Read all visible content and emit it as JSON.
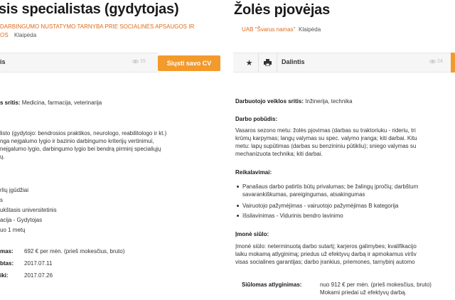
{
  "left": {
    "title": "sis specialistas (gydytojas)",
    "company_line1": "DARBINGUMO NUSTATYMO TARNYBA PRIE SOCIALINĖS APSAUGOS IR",
    "company_line2": "OS",
    "city": "Klaipėda",
    "views": "15",
    "cv_button": "Siųsti savo CV",
    "toolbar_fragment": "is",
    "area_label": "s sritis:",
    "area_value": "Medicina, farmacija, veterinarija",
    "desc_lines": [
      "listo (gydytojo: bendrosios praktikos, neurologo, reabilitologo ir kt.)",
      "nga neįgalumo lygio ir bazinio darbingumo kriterijų vertinimui,",
      "neįgalumo lygio, darbingumo lygio bei bendrą pirminį specialiųjų",
      "ų."
    ],
    "req_lines": [
      "rlių įgūdžiai",
      "s",
      "ukštasis universitetinis",
      "acija - Gydytojas",
      "uo 1 metų"
    ],
    "salary_label": "mas:",
    "salary_value": "692 € per mėn. (prieš mokesčius, bruto)",
    "posted_label": "btas:",
    "posted_value": "2017.07.11",
    "until_label": "iki:",
    "until_value": "2017.07.26"
  },
  "right": {
    "title": "Žolės pjovėjas",
    "company": "UAB \"Švarus namas\"",
    "city": "Klaipėda",
    "share_label": "Dalintis",
    "views": "24",
    "area_label": "Darbuotojo veiklos sritis:",
    "area_value": "Inžinerija, technika",
    "work_heading": "Darbo pobūdis:",
    "work_lines": [
      "Vasaros sezono metu: žolės pjovimas (darbas su traktoriuku - rideriu, tri",
      "krūmų karpymas; langų valymas su spec. valymo įranga; kiti darbai. Kitu",
      "metu: lapų supūtimas (darbas su benzininiu pūtikliu); sniego valymas su",
      "mechanizuota technika; kiti darbai."
    ],
    "req_heading": "Reikalavimai:",
    "req_items": [
      [
        "Panašaus darbo patirtis būtų privalumas; be žalingų įpročių; darbštum",
        "savarankiškumas, pareigingumas, atsakingumas"
      ],
      [
        "Vairuotojo pažymėjimas - vairuotojo pažymėjimas B kategorija"
      ],
      [
        "Išsilavinimas - Vidurinis bendro lavinimo"
      ]
    ],
    "offer_heading": "Įmonė siūlo:",
    "offer_lines": [
      "Įmonė siūlo: neterminuotą darbo sutartį; karjeros galimybes; kvalifikacijo",
      "laiku mokamą atlyginimą; priedus už efektyvų darbą ir apmokamus viršv",
      "visas socialines garantijas; darbo įrankius, priemones, tarnybinį automo"
    ],
    "salary_label": "Siūlomas atlyginimas:",
    "salary_line1": "nuo 912 € per mėn. (prieš mokesčius, bruto)",
    "salary_line2": "Mokami priedai už efektyvų darbą."
  },
  "colors": {
    "accent": "#f39a2c",
    "company": "#e06a1b"
  }
}
